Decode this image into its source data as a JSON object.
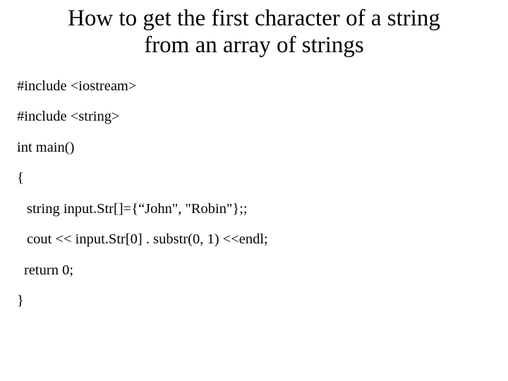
{
  "title_line1": "How to get the first character of a string",
  "title_line2": "from an array of strings",
  "code": {
    "l1": "#include <iostream>",
    "l2": "#include <string>",
    "l3": "int main()",
    "l4": "{",
    "l5": "string input.Str[]={“John\", \"Robin\"};;",
    "l6": "cout << input.Str[0] . substr(0, 1) <<endl;",
    "l7": "return 0;",
    "l8": "}"
  }
}
